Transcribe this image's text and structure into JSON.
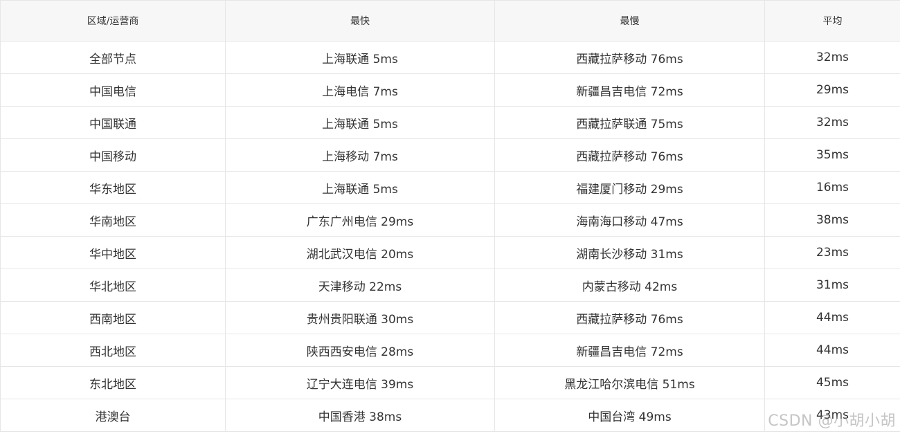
{
  "table": {
    "headers": [
      "区域/运营商",
      "最快",
      "最慢",
      "平均"
    ],
    "rows": [
      [
        "全部节点",
        "上海联通 5ms",
        "西藏拉萨移动 76ms",
        "32ms"
      ],
      [
        "中国电信",
        "上海电信 7ms",
        "新疆昌吉电信 72ms",
        "29ms"
      ],
      [
        "中国联通",
        "上海联通 5ms",
        "西藏拉萨联通 75ms",
        "32ms"
      ],
      [
        "中国移动",
        "上海移动 7ms",
        "西藏拉萨移动 76ms",
        "35ms"
      ],
      [
        "华东地区",
        "上海联通 5ms",
        "福建厦门移动 29ms",
        "16ms"
      ],
      [
        "华南地区",
        "广东广州电信 29ms",
        "海南海口移动 47ms",
        "38ms"
      ],
      [
        "华中地区",
        "湖北武汉电信 20ms",
        "湖南长沙移动 31ms",
        "23ms"
      ],
      [
        "华北地区",
        "天津移动 22ms",
        "内蒙古移动 42ms",
        "31ms"
      ],
      [
        "西南地区",
        "贵州贵阳联通 30ms",
        "西藏拉萨移动 76ms",
        "44ms"
      ],
      [
        "西北地区",
        "陕西西安电信 28ms",
        "新疆昌吉电信 72ms",
        "44ms"
      ],
      [
        "东北地区",
        "辽宁大连电信 39ms",
        "黑龙江哈尔滨电信 51ms",
        "45ms"
      ],
      [
        "港澳台",
        "中国香港 38ms",
        "中国台湾 49ms",
        "43ms"
      ]
    ]
  },
  "watermark": "CSDN @小胡小胡"
}
